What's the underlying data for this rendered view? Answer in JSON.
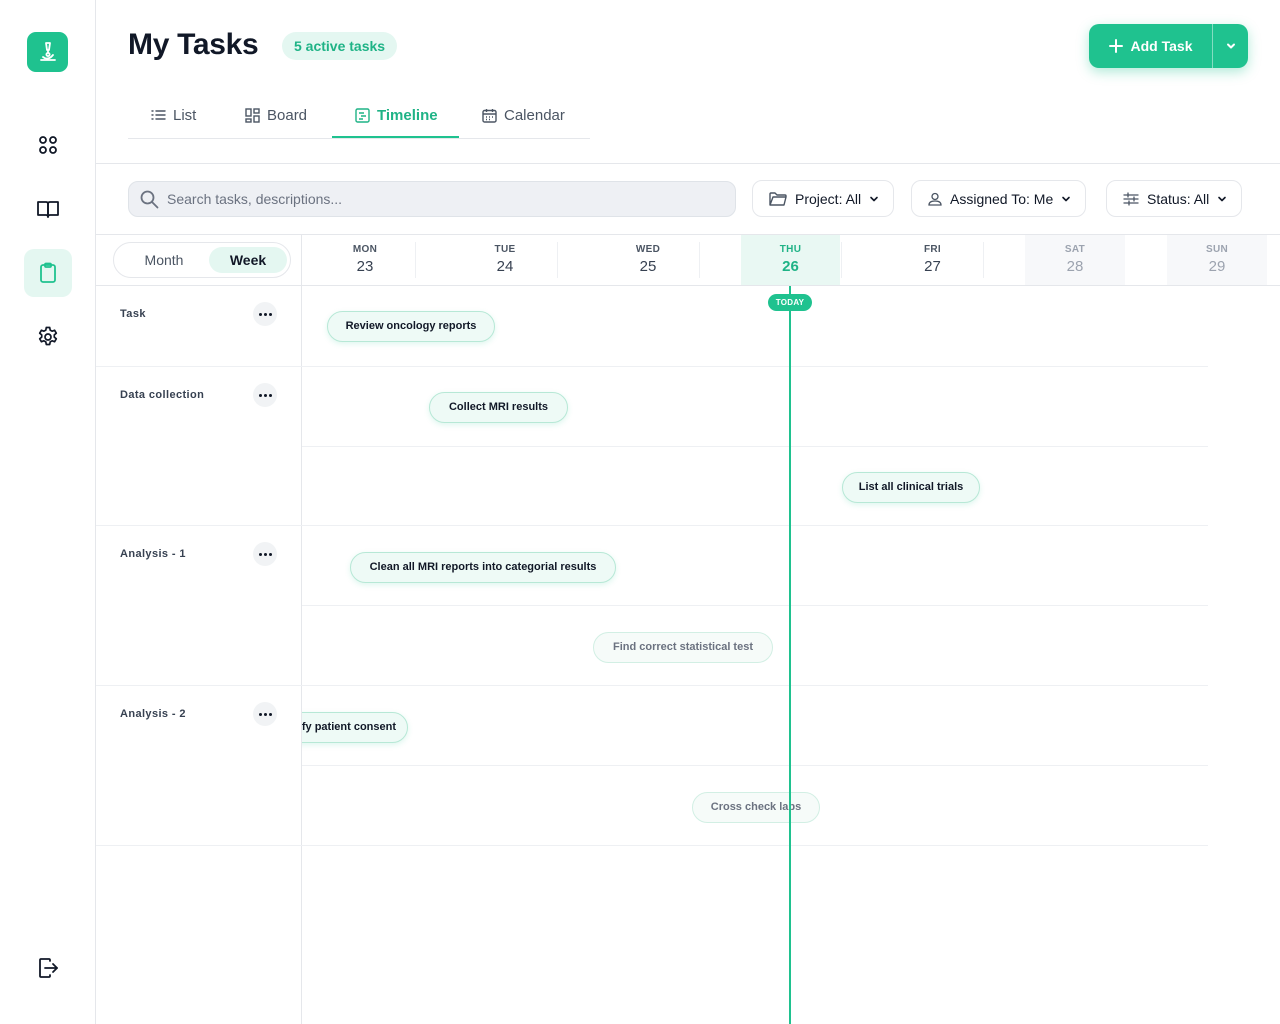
{
  "header": {
    "title": "My Tasks",
    "badge": "5 active tasks",
    "add_task_label": "Add Task"
  },
  "sidebar": {
    "items": [
      {
        "icon": "grid-icon",
        "active": false
      },
      {
        "icon": "book-icon",
        "active": false
      },
      {
        "icon": "clipboard-icon",
        "active": true
      },
      {
        "icon": "gear-icon",
        "active": false
      }
    ],
    "bottom_icon": "logout-icon"
  },
  "tabs": [
    {
      "label": "List",
      "icon": "list-icon"
    },
    {
      "label": "Board",
      "icon": "board-icon"
    },
    {
      "label": "Timeline",
      "icon": "timeline-icon",
      "active": true
    },
    {
      "label": "Calendar",
      "icon": "calendar-icon"
    }
  ],
  "search": {
    "placeholder": "Search tasks, descriptions..."
  },
  "filters": {
    "project": "Project: All",
    "assigned": "Assigned To: Me",
    "status": "Status: All"
  },
  "view_toggle": {
    "month": "Month",
    "week": "Week",
    "selected": "Week"
  },
  "days": [
    {
      "name": "MON",
      "date": "23"
    },
    {
      "name": "TUE",
      "date": "24"
    },
    {
      "name": "WED",
      "date": "25"
    },
    {
      "name": "THU",
      "date": "26",
      "today": true
    },
    {
      "name": "FRI",
      "date": "27"
    },
    {
      "name": "SAT",
      "date": "28",
      "weekend": true
    },
    {
      "name": "SUN",
      "date": "29",
      "weekend": true
    }
  ],
  "today_label": "TODAY",
  "groups": [
    {
      "label": "Task"
    },
    {
      "label": "Data collection"
    },
    {
      "label": "Analysis - 1"
    },
    {
      "label": "Analysis - 2"
    }
  ],
  "tasks": [
    {
      "label": "Review oncology reports"
    },
    {
      "label": "Collect MRI  results"
    },
    {
      "label": "List all clinical trials"
    },
    {
      "label": "Clean all MRI reports into categorial results"
    },
    {
      "label": "Find correct statistical test"
    },
    {
      "label": "Verify patient consent"
    },
    {
      "label": "Cross check labs"
    }
  ],
  "colors": {
    "accent": "#1fc28f",
    "accent_text": "#1fb386",
    "accent_light": "#e4f7f1"
  }
}
